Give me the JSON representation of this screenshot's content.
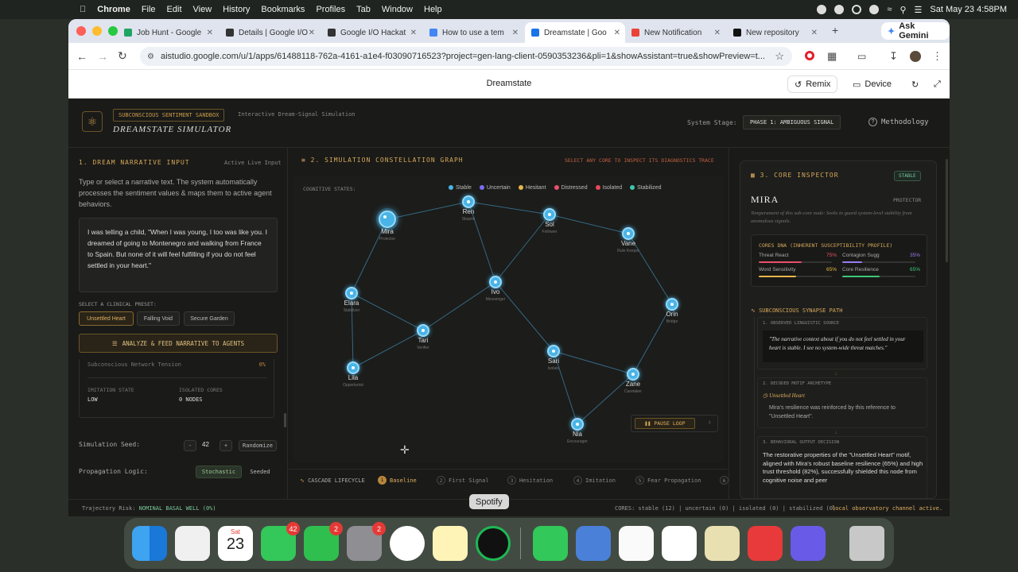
{
  "menubar": {
    "app": "Chrome",
    "items": [
      "File",
      "Edit",
      "View",
      "History",
      "Bookmarks",
      "Profiles",
      "Tab",
      "Window",
      "Help"
    ],
    "datetime": "Sat May 23  4:58PM"
  },
  "tabs": [
    {
      "label": "Job Hunt - Google",
      "color": "#1fa463"
    },
    {
      "label": "Details | Google I/O",
      "color": "#333333"
    },
    {
      "label": "Google I/O Hackat",
      "color": "#333333"
    },
    {
      "label": "How to use a tem",
      "color": "#4285f4"
    },
    {
      "label": "Dreamstate | Goo",
      "color": "#1a73e8"
    },
    {
      "label": "New Notification",
      "color": "#ea4335"
    },
    {
      "label": "New repository",
      "color": "#111111"
    }
  ],
  "ask_gemini": "Ask Gemini",
  "url": "aistudio.google.com/u/1/apps/61488118-762a-4161-a1e4-f030907165​23?project=gen-lang-client-0590353236&pli=1&showAssistant=true&showPreview=t...",
  "appbar": {
    "title": "Dreamstate",
    "remix": "Remix",
    "device": "Device"
  },
  "header": {
    "chip": "SUBCONSCIOUS SENTIMENT SANDBOX",
    "subtitle": "Interactive Dream-Signal Simulation",
    "title": "DREAMSTATE SIMULATOR",
    "stage_label": "System Stage:",
    "stage_value": "PHASE 1: AMBIGUOUS SIGNAL",
    "methodology": "Methodology"
  },
  "left": {
    "title": "1. DREAM NARRATIVE INPUT",
    "live": "Active Live Input",
    "desc": "Type or select a narrative text. The system automatically processes the sentiment values & maps them to active agent behaviors.",
    "narrative": "I was telling a child, \"When I was young, I too was like you. I dreamed of going to Montenegro and walking from France to Spain. But none of it will feel fulfilling if you do not feel settled in your heart.\"",
    "preset_label": "SELECT A CLINICAL PRESET:",
    "presets": [
      "Unsettled Heart",
      "Falling Void",
      "Secure Garden"
    ],
    "analyze": "ANALYZE & FEED NARRATIVE TO AGENTS",
    "tension_label": "Subconscious Network Tension",
    "tension_value": "0%",
    "imitation_label": "IMITATION STATE",
    "imitation_value": "LOW",
    "isolated_label": "ISOLATED CORES",
    "isolated_value": "0 NODES",
    "seed_label": "Simulation Seed:",
    "seed_minus": "-",
    "seed_value": "42",
    "seed_plus": "+",
    "randomize": "Randomize",
    "prop_label": "Propagation Logic:",
    "prop_options": [
      "Stochastic",
      "Seeded"
    ]
  },
  "graph": {
    "title": "2. SIMULATION CONSTELLATION GRAPH",
    "hint": "SELECT ANY CORE TO INSPECT ITS DIAGNOSTICS TRACE",
    "states_label": "COGNITIVE STATES:",
    "legend": [
      {
        "name": "Stable",
        "color": "#48b4e8"
      },
      {
        "name": "Uncertain",
        "color": "#7b6cf0"
      },
      {
        "name": "Hesitant",
        "color": "#e8b64a"
      },
      {
        "name": "Distressed",
        "color": "#e8506a"
      },
      {
        "name": "Isolated",
        "color": "#e84858"
      },
      {
        "name": "Stabilized",
        "color": "#3cc8b0"
      }
    ],
    "nodes": [
      {
        "name": "Mira",
        "role": "Protector"
      },
      {
        "name": "Ren",
        "role": "Skeptic"
      },
      {
        "name": "Sol",
        "role": "Follower"
      },
      {
        "name": "Vane",
        "role": "Rule Keeper"
      },
      {
        "name": "Elara",
        "role": "Stabilizer"
      },
      {
        "name": "Ivo",
        "role": "Messenger"
      },
      {
        "name": "Orin",
        "role": "Bridge"
      },
      {
        "name": "Tari",
        "role": "Verifier"
      },
      {
        "name": "Sari",
        "role": "Isolate"
      },
      {
        "name": "Lila",
        "role": "Opportunist"
      },
      {
        "name": "Zane",
        "role": "Caretaker"
      },
      {
        "name": "Nia",
        "role": "Encourager"
      }
    ],
    "pause": "PAUSE LOOP",
    "lifecycle_label": "CASCADE LIFECYCLE",
    "steps": [
      {
        "num": "1",
        "label": "Baseline"
      },
      {
        "num": "2",
        "label": "First Signal"
      },
      {
        "num": "3",
        "label": "Hesitation"
      },
      {
        "num": "4",
        "label": "Imitation"
      },
      {
        "num": "5",
        "label": "Fear Propagation"
      },
      {
        "num": "6",
        "label": ""
      }
    ]
  },
  "inspector": {
    "title": "3. CORE INSPECTOR",
    "status": "STABLE",
    "name": "MIRA",
    "role": "PROTECTOR",
    "desc": "Temperament of this sub-core node: Seeks to guard system-level stability from anomalous signals.",
    "dna_title": "CORES DNA (INHERENT SUSCEPTIBILITY PROFILE)",
    "stats": [
      {
        "label": "Threat React",
        "value": "75%",
        "pct": 75,
        "color": "#e8506a"
      },
      {
        "label": "Contagion Sugg",
        "value": "35%",
        "pct": 35,
        "color": "#9b7cf0"
      },
      {
        "label": "Word Sensitivity",
        "value": "65%",
        "pct": 65,
        "color": "#e8b64a"
      },
      {
        "label": "Core Resilience",
        "value": "65%",
        "pct": 65,
        "color": "#3cc87a"
      }
    ],
    "synapse_title": "SUBCONSCIOUS SYNAPSE PATH",
    "s1_title": "1. OBSERVED LINGUISTIC SOURCE",
    "s1_text": "\"The narrative context about if you do not feel settled in your heart is stable. I see no system-wide threat matches.\"",
    "s2_title": "2. DECODED MOTIF ARCHETYPE",
    "s2_motif": "Unsettled Heart",
    "s2_text": "Mira's resilience was reinforced by this reference to \"Unsettled Heart\".",
    "s3_title": "3. BEHAVIORAL OUTPUT DECISION",
    "s3_text": "The restorative properties of the \"Unsettled Heart\" motif, aligned with Mira's robust baseline resilience (65%) and high trust threshold (82%), successfully shielded this node from cognitive noise and peer"
  },
  "footer": {
    "risk_label": "Trajectory Risk:",
    "risk_value": "NOMINAL BASAL WELL (0%)",
    "cores": "CORES: stable (12) | uncertain (0) | isolated (0) | stabilized (0)",
    "channel": "local observatory channel active."
  },
  "tooltip": "Spotify",
  "dock": {
    "calendar_month": "Sat",
    "calendar_day": "23",
    "badge_messages": "42",
    "badge_facetime": "2",
    "badge_settings": "2"
  }
}
